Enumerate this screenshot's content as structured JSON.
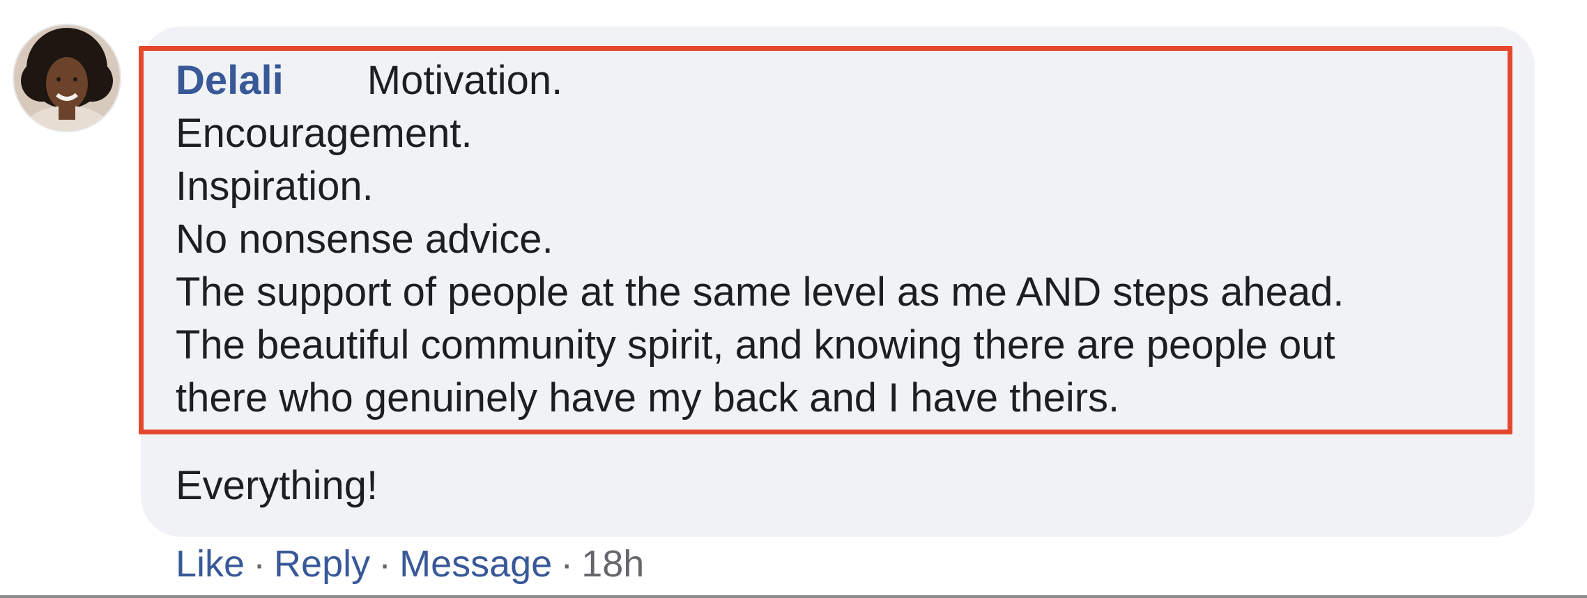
{
  "comment": {
    "author": "Delali",
    "first_line": "Motivation.",
    "highlighted_lines": [
      "Encouragement.",
      "Inspiration.",
      "No nonsense advice.",
      "The support of people at the same level as me AND steps ahead.",
      "The beautiful community spirit, and knowing there are people out",
      "there who genuinely have my back and I have theirs."
    ],
    "closing_line": "Everything!"
  },
  "actions": {
    "like": "Like",
    "reply": "Reply",
    "message": "Message",
    "separator": "·",
    "time": "18h"
  },
  "colors": {
    "link": "#385898",
    "text": "#1c1e21",
    "bubble": "#f0f2f5",
    "highlight_border": "#e5472c",
    "meta": "#65676b"
  },
  "icons": {
    "avatar": "profile-photo"
  }
}
